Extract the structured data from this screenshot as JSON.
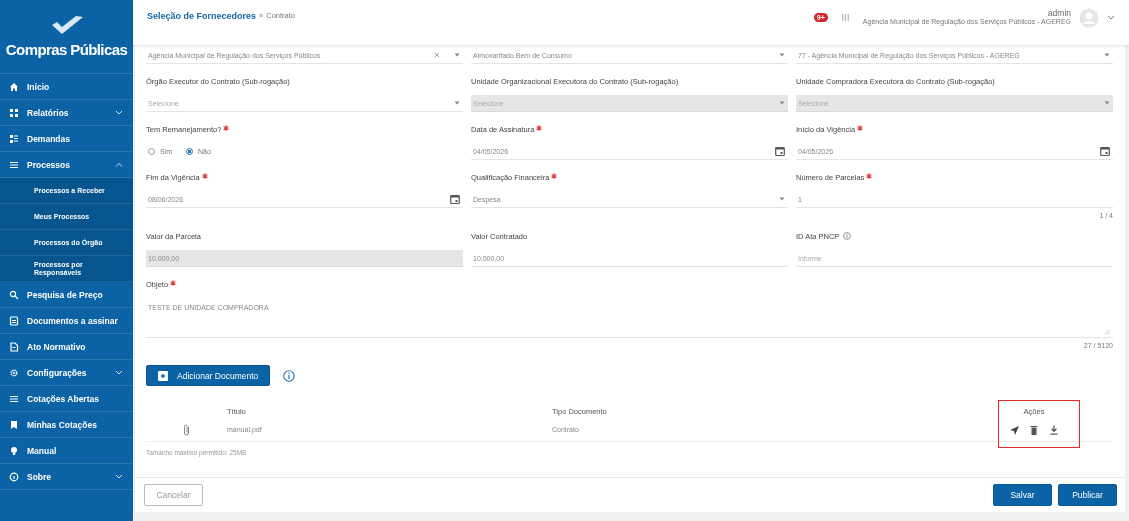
{
  "sidebar": {
    "brand": "Compras Públicas",
    "items": [
      {
        "label": "Início",
        "kind": "link"
      },
      {
        "label": "Relatórios",
        "kind": "group",
        "expanded": false
      },
      {
        "label": "Demandas",
        "kind": "link"
      },
      {
        "label": "Processos",
        "kind": "group",
        "expanded": true,
        "children": [
          {
            "label": "Processos a Receber"
          },
          {
            "label": "Meus Processos"
          },
          {
            "label": "Processos do Órgão"
          },
          {
            "label": "Processos por Responsáveis"
          }
        ]
      },
      {
        "label": "Pesquisa de Preço",
        "kind": "link"
      },
      {
        "label": "Documentos a assinar",
        "kind": "link"
      },
      {
        "label": "Ato Normativo",
        "kind": "link"
      },
      {
        "label": "Configurações",
        "kind": "group",
        "expanded": false
      },
      {
        "label": "Cotações Abertas",
        "kind": "link"
      },
      {
        "label": "Minhas Cotações",
        "kind": "link"
      },
      {
        "label": "Manual",
        "kind": "link"
      },
      {
        "label": "Sobre",
        "kind": "group",
        "expanded": false
      }
    ]
  },
  "topbar": {
    "breadcrumb": {
      "section": "Seleção de Fornecedores",
      "separator": "»",
      "page": "Contrato"
    },
    "notification_badge": "9+",
    "user": {
      "name": "admin",
      "organization": "Agência Municipal de Regulação dos Serviços Públicos - AGEREG"
    }
  },
  "form": {
    "fields": [
      {
        "kind": "select",
        "value": "Agência Municipal de Regulação dos Serviços Públicos",
        "clearable": true,
        "disabled": false
      },
      {
        "kind": "select",
        "value": "Almoxarifado Bem de Consumo",
        "disabled": false
      },
      {
        "kind": "select",
        "value": "77 - Agência Municipal de Regulação dos Serviços Públicos - AGEREG",
        "disabled": false
      },
      {
        "kind": "select",
        "label": "Órgão Executor do Contrato (Sub-rogação)",
        "placeholder": "Selecione",
        "disabled": false
      },
      {
        "kind": "select",
        "label": "Unidade Organizacional Executora do Contrato (Sub-rogação)",
        "placeholder": "Selecione",
        "disabled": true
      },
      {
        "kind": "select",
        "label": "Unidade Compradora Executora do Contrato (Sub-rogação)",
        "placeholder": "Selecione",
        "disabled": true
      },
      {
        "kind": "radio",
        "label": "Tem Remanejamento?",
        "required": true,
        "options": [
          {
            "label": "Sim",
            "selected": false
          },
          {
            "label": "Não",
            "selected": true
          }
        ]
      },
      {
        "kind": "date",
        "label": "Data de Assinatura",
        "required": true,
        "value": "04/05/2026",
        "disabled": false
      },
      {
        "kind": "date",
        "label": "Início da Vigência",
        "required": true,
        "value": "04/05/2026",
        "disabled": false
      },
      {
        "kind": "date",
        "label": "Fim da Vigência",
        "required": true,
        "value": "08/06/2026",
        "disabled": false
      },
      {
        "kind": "select",
        "label": "Qualificação Financeira",
        "required": true,
        "value": "Despesa",
        "disabled": false
      },
      {
        "kind": "text",
        "label": "Número de Parcelas",
        "required": true,
        "value": "1",
        "counter": "1 / 4",
        "disabled": false
      },
      {
        "kind": "text",
        "label": "Valor da Parcela",
        "value": "10.000,00",
        "disabled": true
      },
      {
        "kind": "text",
        "label": "Valor Contratado",
        "value": "10.000,00",
        "disabled": false
      },
      {
        "kind": "text",
        "label": "ID Ata PNCP",
        "info": true,
        "placeholder": "Informe",
        "disabled": false
      },
      {
        "kind": "textarea",
        "label": "Objeto",
        "required": true,
        "value": "TESTE DE UNIDADE COMPRADORA",
        "counter": "27 / 5120",
        "disabled": false
      }
    ]
  },
  "documents": {
    "add_button": "Adicionar Documento",
    "columns": [
      "Título",
      "Tipo Documento",
      "Ações"
    ],
    "actions_highlighted": true,
    "rows": [
      {
        "title": "manual.pdf",
        "type": "Contrato"
      }
    ],
    "note": "Tamanho máximo permitido: 25MB"
  },
  "footer": {
    "buttons": [
      {
        "label": "Cancelar",
        "kind": "secondary"
      },
      {
        "label": "Salvar",
        "kind": "primary"
      },
      {
        "label": "Publicar",
        "kind": "primary"
      }
    ]
  }
}
